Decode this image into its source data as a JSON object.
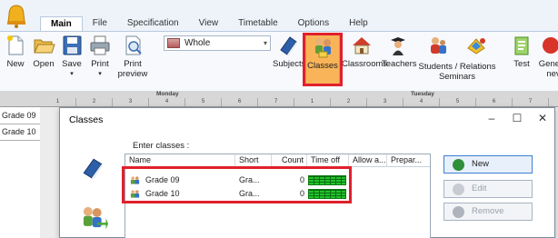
{
  "ribbon": {
    "tabs": [
      "Main",
      "File",
      "Specification",
      "View",
      "Timetable",
      "Options",
      "Help"
    ],
    "active_tab": "Main",
    "combo_value": "Whole",
    "buttons": {
      "new": "New",
      "open": "Open",
      "save": "Save",
      "print": "Print",
      "print_preview_1": "Print",
      "print_preview_2": "preview",
      "subjects": "Subjects",
      "classes": "Classes",
      "classrooms": "Classrooms",
      "teachers": "Teachers",
      "students_relations_1": "Students / Relations",
      "students_relations_2": "Seminars",
      "test": "Test",
      "generate_1": "Gener",
      "generate_2": "nev"
    },
    "icons": [
      "app-bell-icon",
      "new-document-icon",
      "open-folder-icon",
      "save-disk-icon",
      "printer-icon",
      "print-preview-icon",
      "whole-view-icon",
      "subjects-book-icon",
      "classes-group-icon",
      "classrooms-house-icon",
      "teachers-graduate-icon",
      "students-icon",
      "relations-icon",
      "test-icon",
      "generate-icon"
    ]
  },
  "timetable": {
    "days": [
      "Monday",
      "Tuesday"
    ],
    "periods": [
      "1",
      "2",
      "3",
      "4",
      "5",
      "6",
      "7",
      "1",
      "2",
      "3",
      "4",
      "5",
      "6",
      "7"
    ],
    "rows": [
      "Grade 09",
      "Grade 10"
    ]
  },
  "dialog": {
    "title": "Classes",
    "controls": {
      "minimize": "–",
      "maximize": "☐",
      "close": "✕"
    },
    "enter_label": "Enter classes :",
    "columns": [
      "Name",
      "Short",
      "Count",
      "Time off",
      "Allow a...",
      "Prepar..."
    ],
    "rows": [
      {
        "name": "Grade 09",
        "short": "Gra...",
        "count": "0",
        "time_off": "available"
      },
      {
        "name": "Grade 10",
        "short": "Gra...",
        "count": "0",
        "time_off": "available"
      }
    ],
    "buttons": {
      "new": "New",
      "edit": "Edit",
      "remove": "Remove"
    }
  },
  "colors": {
    "highlight": "#f9b45a",
    "annotation_red": "#e0202c",
    "timeoff_green": "#22c42a",
    "primary_blue": "#3c7fd1"
  }
}
